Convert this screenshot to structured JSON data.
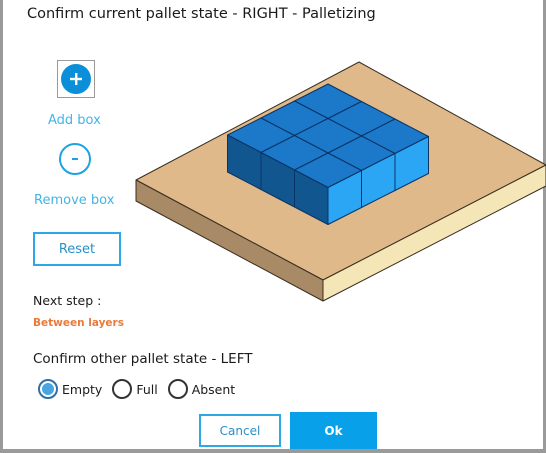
{
  "title": "Confirm current pallet state - RIGHT - Palletizing",
  "add_box": {
    "label": "Add box",
    "icon": "plus-icon",
    "symbol": "+"
  },
  "remove_box": {
    "label": "Remove box",
    "icon": "minus-icon",
    "symbol": "-"
  },
  "reset_label": "Reset",
  "next_step": {
    "label": "Next step :",
    "value": "Between layers"
  },
  "confirm_other": {
    "label": "Confirm other pallet state - LEFT",
    "options": [
      {
        "label": "Empty",
        "selected": true
      },
      {
        "label": "Full",
        "selected": false
      },
      {
        "label": "Absent",
        "selected": false
      }
    ]
  },
  "buttons": {
    "cancel": "Cancel",
    "ok": "Ok"
  },
  "pallet": {
    "boxes_per_row": 3,
    "rows": 3,
    "layers": 1,
    "colors": {
      "pallet_top": "#dfb98a",
      "pallet_left": "#a88a66",
      "pallet_front": "#f5e6b8",
      "box_top": "#1c78c8",
      "box_left": "#11568f",
      "box_right": "#2aa6f5",
      "box_edge": "#0a3466"
    }
  },
  "colors": {
    "accent": "#08a0e8",
    "link_text": "#43b4e6",
    "next_step_value": "#e97a3a"
  }
}
